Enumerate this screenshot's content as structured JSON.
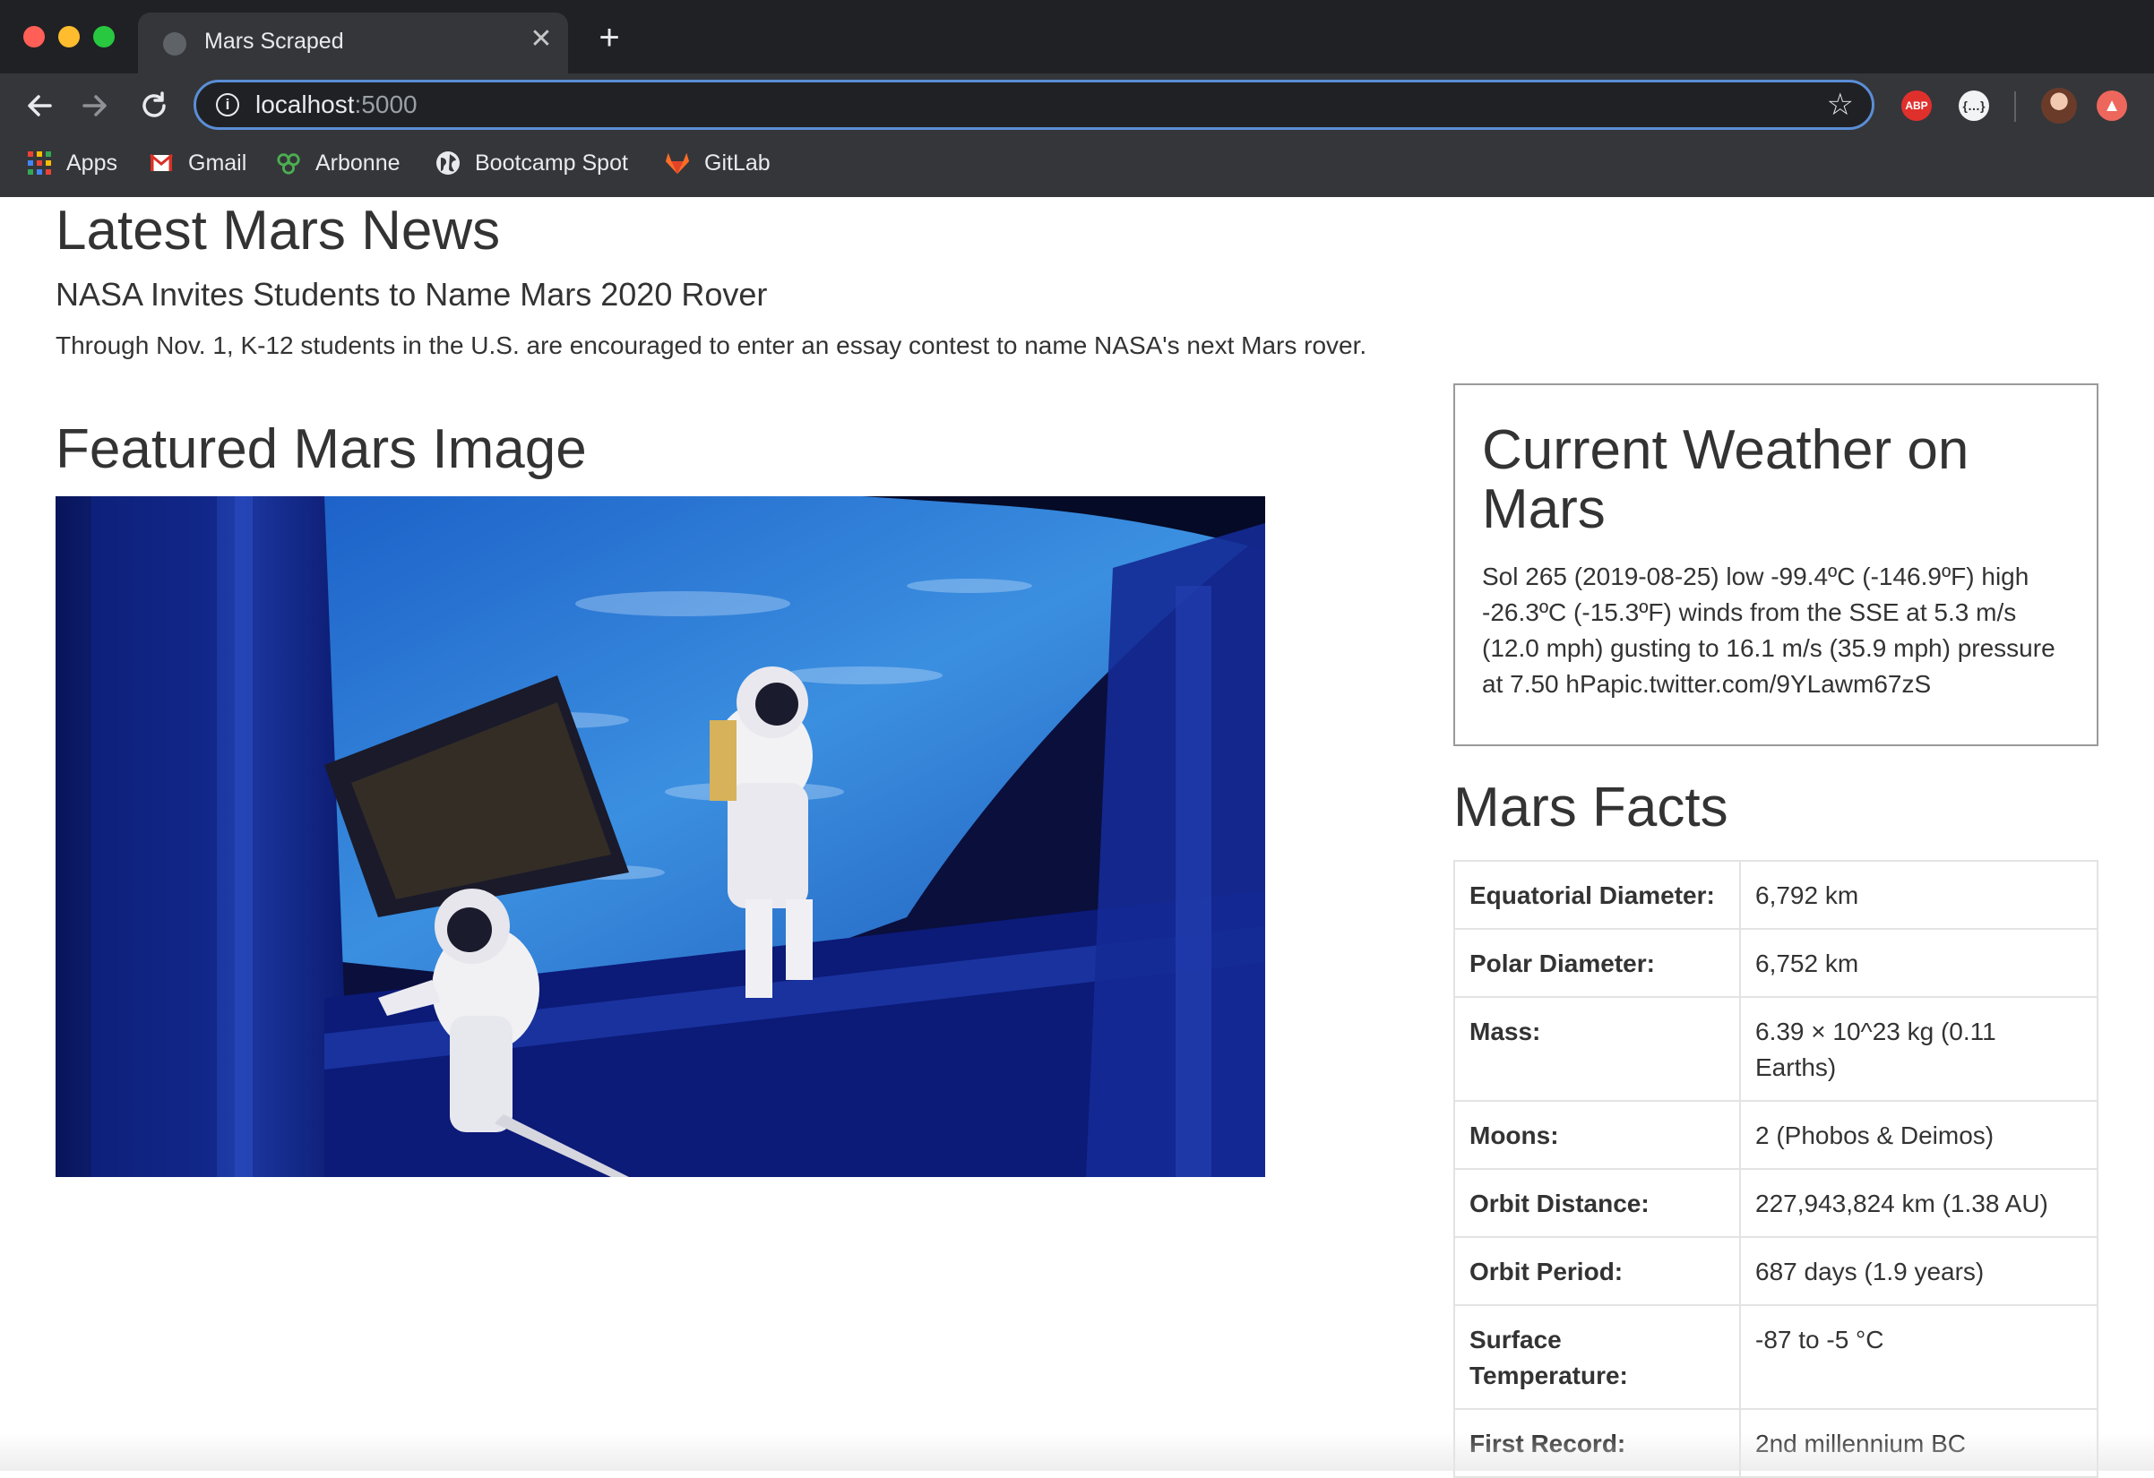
{
  "browser": {
    "tab_title": "Mars Scraped",
    "tab_close": "✕",
    "new_tab": "+",
    "url_host": "localhost",
    "url_port": ":5000",
    "bookmarks": [
      {
        "label": "Apps",
        "icon": "apps-grid-icon"
      },
      {
        "label": "Gmail",
        "icon": "gmail-icon"
      },
      {
        "label": "Arbonne",
        "icon": "arbonne-icon"
      },
      {
        "label": "Bootcamp Spot",
        "icon": "globe-icon"
      },
      {
        "label": "GitLab",
        "icon": "gitlab-icon"
      }
    ],
    "extensions": {
      "abp": "ABP",
      "json": "{…}"
    }
  },
  "news": {
    "heading": "Latest Mars News",
    "title": "NASA Invites Students to Name Mars 2020 Rover",
    "paragraph": "Through Nov. 1, K-12 students in the U.S. are encouraged to enter an essay contest to name NASA's next Mars rover."
  },
  "featured": {
    "heading": "Featured Mars Image",
    "image_subject": "astronauts-spacewalk-over-earth"
  },
  "weather": {
    "heading": "Current Weather on Mars",
    "text": "Sol 265 (2019-08-25) low -99.4ºC (-146.9ºF) high -26.3ºC (-15.3ºF) winds from the SSE at 5.3 m/s (12.0 mph) gusting to 16.1 m/s (35.9 mph) pressure at 7.50 hPapic.twitter.com/9YLawm67zS"
  },
  "facts": {
    "heading": "Mars Facts",
    "rows": [
      {
        "key": "Equatorial Diameter:",
        "value": "6,792 km"
      },
      {
        "key": "Polar Diameter:",
        "value": "6,752 km"
      },
      {
        "key": "Mass:",
        "value": "6.39 × 10^23 kg (0.11 Earths)"
      },
      {
        "key": "Moons:",
        "value": "2 (Phobos & Deimos)"
      },
      {
        "key": "Orbit Distance:",
        "value": "227,943,824 km (1.38 AU)"
      },
      {
        "key": "Orbit Period:",
        "value": "687 days (1.9 years)"
      },
      {
        "key": "Surface Temperature:",
        "value": "-87 to -5 °C"
      },
      {
        "key": "First Record:",
        "value": "2nd millennium BC"
      }
    ]
  },
  "colors": {
    "chrome_dark": "#202124",
    "chrome_toolbar": "#35363a",
    "omnibox_focus": "#5a8ed6",
    "text": "#333333"
  }
}
